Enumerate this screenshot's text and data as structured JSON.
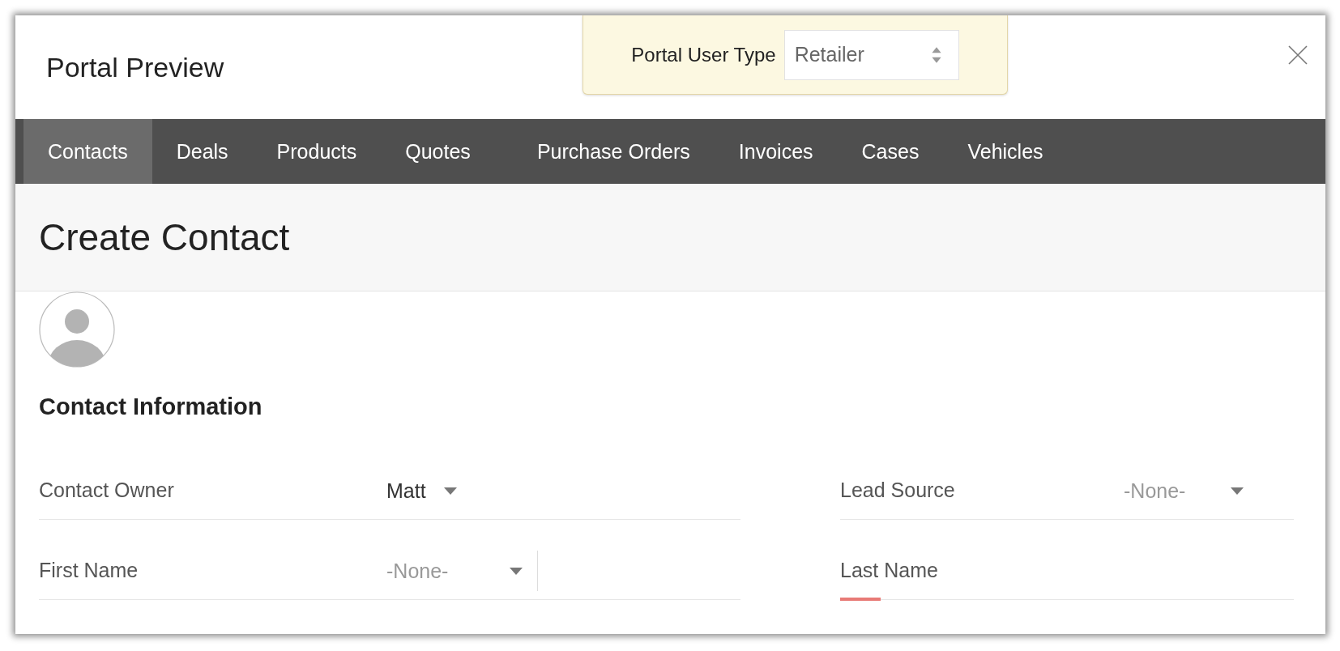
{
  "window": {
    "title": "Portal Preview"
  },
  "user_type": {
    "label": "Portal User Type",
    "value": "Retailer"
  },
  "tabs": [
    {
      "label": "Contacts",
      "selected": true
    },
    {
      "label": "Deals",
      "selected": false
    },
    {
      "label": "Products",
      "selected": false
    },
    {
      "label": "Quotes",
      "selected": false
    },
    {
      "label": "Purchase Orders",
      "selected": false
    },
    {
      "label": "Invoices",
      "selected": false
    },
    {
      "label": "Cases",
      "selected": false
    },
    {
      "label": "Vehicles",
      "selected": false
    }
  ],
  "page_title": "Create Contact",
  "section": {
    "title": "Contact Information"
  },
  "fields_left": [
    {
      "label": "Contact Owner",
      "kind": "select",
      "value": "Matt",
      "muted": false,
      "required": false
    },
    {
      "label": "First Name",
      "kind": "salutation",
      "value": "-None-",
      "muted": true,
      "required": false
    }
  ],
  "fields_right": [
    {
      "label": "Lead Source",
      "kind": "select",
      "value": "-None-",
      "muted": true,
      "required": false
    },
    {
      "label": "Last Name",
      "kind": "text",
      "required": true
    }
  ]
}
